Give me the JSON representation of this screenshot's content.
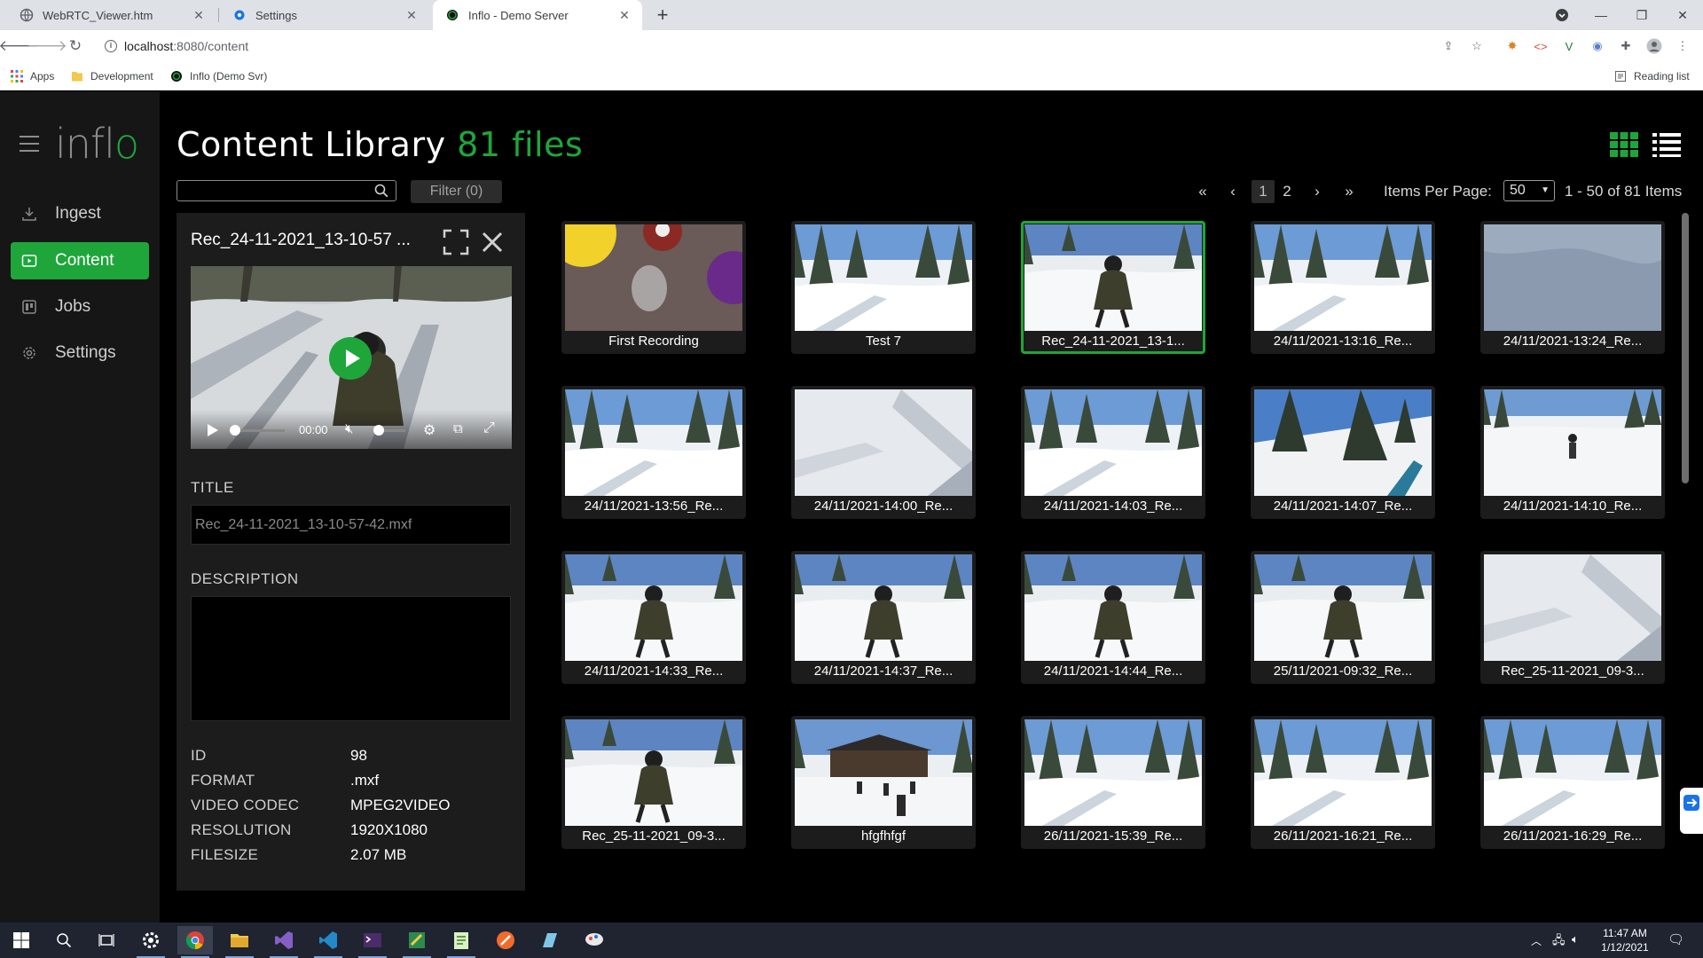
{
  "browser": {
    "tabs": [
      {
        "title": "WebRTC_Viewer.htm",
        "active": false
      },
      {
        "title": "Settings",
        "active": false
      },
      {
        "title": "Inflo - Demo Server",
        "active": true
      }
    ],
    "url_host": "localhost",
    "url_rest": ":8080/content",
    "bookmarks": [
      "Apps",
      "Development",
      "Inflo (Demo Svr)"
    ],
    "reading_list": "Reading list"
  },
  "app": {
    "logo": "inflo",
    "nav": [
      {
        "label": "Ingest",
        "icon": "download-icon",
        "active": false
      },
      {
        "label": "Content",
        "icon": "video-icon",
        "active": true
      },
      {
        "label": "Jobs",
        "icon": "jobs-icon",
        "active": false
      },
      {
        "label": "Settings",
        "icon": "gear-icon",
        "active": false
      }
    ],
    "page_title": "Content Library",
    "file_count": "81 files",
    "search_placeholder": "",
    "filter_label": "Filter (0)",
    "pagination": {
      "pages": [
        "1",
        "2"
      ],
      "current": "1",
      "items_per_page_label": "Items Per Page:",
      "items_per_page": "50",
      "range_label": "1 - 50 of 81 Items"
    },
    "accent_color": "#1ea63b"
  },
  "details": {
    "header_title": "Rec_24-11-2021_13-10-57 ...",
    "player_time": "00:00",
    "title_label": "TITLE",
    "title_value": "Rec_24-11-2021_13-10-57-42.mxf",
    "description_label": "DESCRIPTION",
    "description_value": "",
    "meta": [
      {
        "key": "ID",
        "value": "98"
      },
      {
        "key": "FORMAT",
        "value": ".mxf"
      },
      {
        "key": "VIDEO CODEC",
        "value": "MPEG2VIDEO"
      },
      {
        "key": "RESOLUTION",
        "value": "1920X1080"
      },
      {
        "key": "FILESIZE",
        "value": "2.07 MB"
      }
    ]
  },
  "grid": [
    {
      "label": "First Recording",
      "scene": "balls",
      "selected": false
    },
    {
      "label": "Test 7",
      "scene": "trees",
      "selected": false
    },
    {
      "label": "Rec_24-11-2021_13-1...",
      "scene": "rider",
      "selected": true
    },
    {
      "label": "24/11/2021-13:16_Re...",
      "scene": "trees",
      "selected": false
    },
    {
      "label": "24/11/2021-13:24_Re...",
      "scene": "snowdark",
      "selected": false
    },
    {
      "label": "24/11/2021-13:56_Re...",
      "scene": "trees",
      "selected": false
    },
    {
      "label": "24/11/2021-14:00_Re...",
      "scene": "snow",
      "selected": false
    },
    {
      "label": "24/11/2021-14:03_Re...",
      "scene": "trees",
      "selected": false
    },
    {
      "label": "24/11/2021-14:07_Re...",
      "scene": "sky",
      "selected": false
    },
    {
      "label": "24/11/2021-14:10_Re...",
      "scene": "slope",
      "selected": false
    },
    {
      "label": "24/11/2021-14:33_Re...",
      "scene": "rider",
      "selected": false
    },
    {
      "label": "24/11/2021-14:37_Re...",
      "scene": "rider",
      "selected": false
    },
    {
      "label": "24/11/2021-14:44_Re...",
      "scene": "rider",
      "selected": false
    },
    {
      "label": "25/11/2021-09:32_Re...",
      "scene": "rider",
      "selected": false
    },
    {
      "label": "Rec_25-11-2021_09-3...",
      "scene": "snow",
      "selected": false
    },
    {
      "label": "Rec_25-11-2021_09-3...",
      "scene": "rider",
      "selected": false
    },
    {
      "label": "hfgfhfgf",
      "scene": "lodge",
      "selected": false
    },
    {
      "label": "26/11/2021-15:39_Re...",
      "scene": "trees",
      "selected": false
    },
    {
      "label": "26/11/2021-16:21_Re...",
      "scene": "trees",
      "selected": false
    },
    {
      "label": "26/11/2021-16:29_Re...",
      "scene": "trees",
      "selected": false
    }
  ],
  "taskbar": {
    "time": "11:47 AM",
    "date": "1/12/2021"
  }
}
